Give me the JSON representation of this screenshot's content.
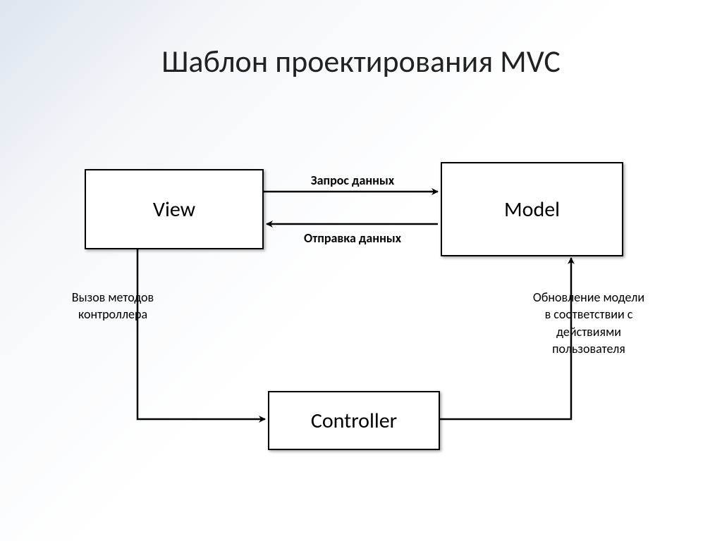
{
  "title": "Шаблон проектирования MVC",
  "boxes": {
    "view": "View",
    "model": "Model",
    "controller": "Controller"
  },
  "labels": {
    "request_data": "Запрос данных",
    "send_data": "Отправка данных",
    "call_methods_line1": "Вызов методов",
    "call_methods_line2": "контроллера",
    "update_model_line1": "Обновление модели",
    "update_model_line2": "в соответствии с",
    "update_model_line3": "действиями",
    "update_model_line4": "пользователя"
  }
}
